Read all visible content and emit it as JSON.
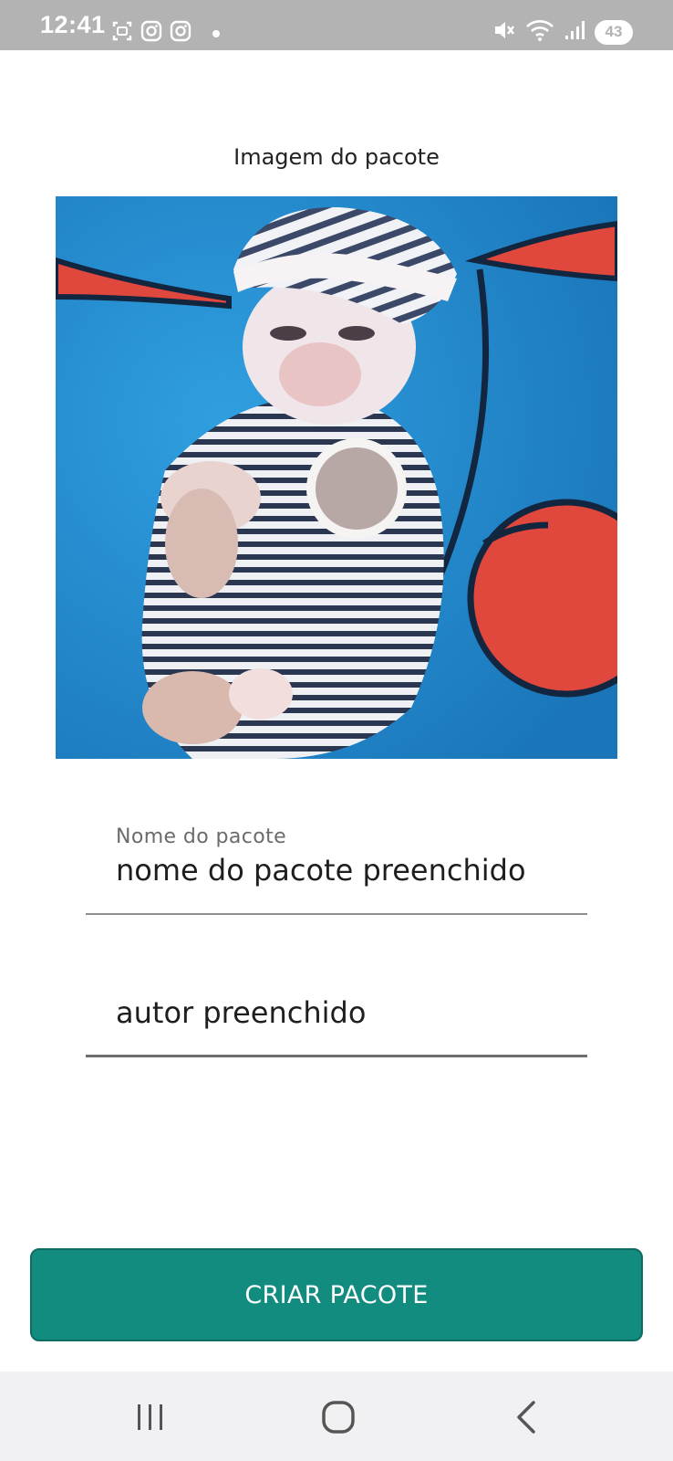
{
  "status_bar": {
    "time": "12:41",
    "battery": "43",
    "left_icons": [
      "screenshot-icon",
      "instagram-icon",
      "instagram-icon",
      "notification-dot-icon"
    ],
    "right_icons": [
      "mute-icon",
      "wifi-icon",
      "signal-icon"
    ]
  },
  "form": {
    "image_label": "Imagem do pacote",
    "name_field": {
      "label": "Nome do pacote",
      "value": "nome do pacote preenchido"
    },
    "author_field": {
      "value": "autor preenchido"
    },
    "submit_label": "CRIAR PACOTE"
  },
  "navigation": {
    "buttons": [
      "recent-apps-icon",
      "home-icon",
      "back-icon"
    ]
  },
  "colors": {
    "status_bar": "#b3b3b3",
    "accent": "#128c7e",
    "nav_bar": "#f1f1f3"
  }
}
